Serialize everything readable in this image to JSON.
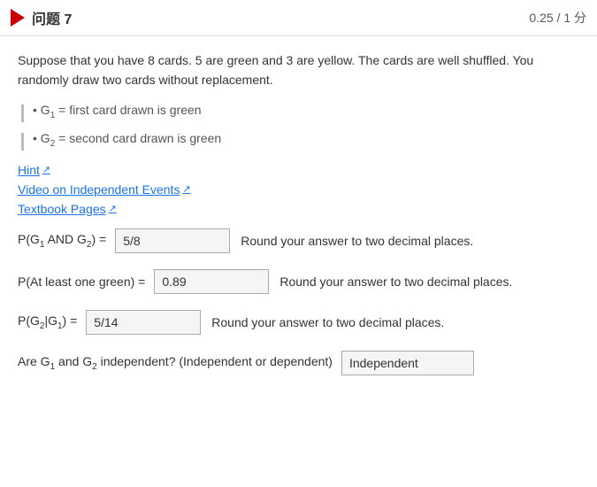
{
  "header": {
    "question_label": "问题 7",
    "score": "0.25 / 1 分"
  },
  "problem": {
    "text": "Suppose that you have 8 cards. 5 are green and 3 are yellow. The cards are well shuffled. You randomly draw two cards without replacement.",
    "bullets": [
      {
        "id": "b1",
        "text": "• G₁ = first card drawn is green"
      },
      {
        "id": "b2",
        "text": "• G₂ = second card drawn is green"
      }
    ]
  },
  "links": [
    {
      "id": "hint",
      "label": "Hint",
      "icon": "↗"
    },
    {
      "id": "video",
      "label": "Video on Independent Events",
      "icon": "↗"
    },
    {
      "id": "textbook",
      "label": "Textbook Pages",
      "icon": "↗"
    }
  ],
  "questions": [
    {
      "id": "q1",
      "label_html": "P(G₁ AND G₂) =",
      "value": "5/8",
      "round_note": "Round your answer to two decimal places."
    },
    {
      "id": "q2",
      "label_html": "P(At least one green) =",
      "value": "0.89",
      "round_note": "Round your answer to two decimal places."
    },
    {
      "id": "q3",
      "label_html": "P(G₂|G₁) =",
      "value": "5/14",
      "round_note": "Round your answer to two decimal places."
    },
    {
      "id": "q4",
      "label_html": "Are G₁ and G₂ independent? (Independent or dependent)",
      "value": "Independent",
      "round_note": ""
    }
  ]
}
